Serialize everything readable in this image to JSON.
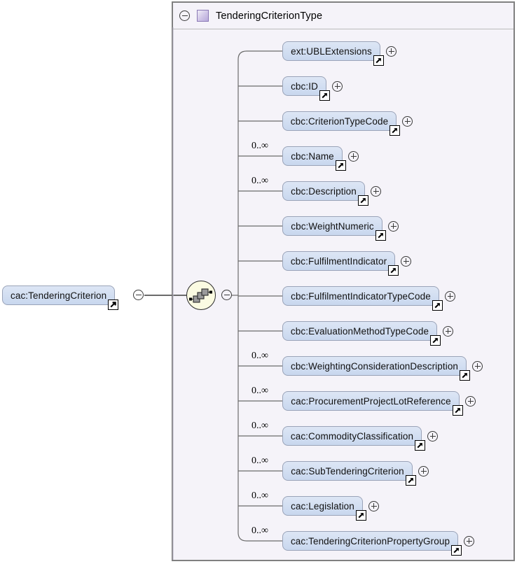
{
  "diagram": {
    "kind": "xsd-schema-diagram",
    "colors": {
      "panel_background": "#f5f3f9",
      "panel_border": "#808080",
      "node_fill_top": "#dde6f5",
      "node_fill_bottom": "#c8d7ee",
      "node_border": "#9aa3b8",
      "compositor_fill": "#fbfbe2",
      "type_swatch": "#b7a9dc",
      "line": "#6b6b6b"
    }
  },
  "root_element": {
    "label": "cac:TenderingCriterion",
    "toggle_icon": "minus-circle-icon",
    "reference_icon": "external-reference-arrow-icon",
    "expanded": true
  },
  "type_panel": {
    "toggle_icon": "minus-circle-icon",
    "swatch_icon": "complex-type-swatch-icon",
    "title": "TenderingCriterionType"
  },
  "compositor": {
    "kind": "sequence",
    "icon": "sequence-compositor-icon",
    "toggle_icon": "minus-circle-icon",
    "expanded": true
  },
  "children": [
    {
      "label": "ext:UBLExtensions",
      "cardinality": "",
      "expand_icon": "plus-circle-icon",
      "reference_icon": "external-reference-arrow-icon"
    },
    {
      "label": "cbc:ID",
      "cardinality": "",
      "expand_icon": "plus-circle-icon",
      "reference_icon": "external-reference-arrow-icon"
    },
    {
      "label": "cbc:CriterionTypeCode",
      "cardinality": "",
      "expand_icon": "plus-circle-icon",
      "reference_icon": "external-reference-arrow-icon"
    },
    {
      "label": "cbc:Name",
      "cardinality": "0..∞",
      "expand_icon": "plus-circle-icon",
      "reference_icon": "external-reference-arrow-icon"
    },
    {
      "label": "cbc:Description",
      "cardinality": "0..∞",
      "expand_icon": "plus-circle-icon",
      "reference_icon": "external-reference-arrow-icon"
    },
    {
      "label": "cbc:WeightNumeric",
      "cardinality": "",
      "expand_icon": "plus-circle-icon",
      "reference_icon": "external-reference-arrow-icon"
    },
    {
      "label": "cbc:FulfilmentIndicator",
      "cardinality": "",
      "expand_icon": "plus-circle-icon",
      "reference_icon": "external-reference-arrow-icon"
    },
    {
      "label": "cbc:FulfilmentIndicatorTypeCode",
      "cardinality": "",
      "expand_icon": "plus-circle-icon",
      "reference_icon": "external-reference-arrow-icon"
    },
    {
      "label": "cbc:EvaluationMethodTypeCode",
      "cardinality": "",
      "expand_icon": "plus-circle-icon",
      "reference_icon": "external-reference-arrow-icon"
    },
    {
      "label": "cbc:WeightingConsiderationDescription",
      "cardinality": "0..∞",
      "expand_icon": "plus-circle-icon",
      "reference_icon": "external-reference-arrow-icon"
    },
    {
      "label": "cac:ProcurementProjectLotReference",
      "cardinality": "0..∞",
      "expand_icon": "plus-circle-icon",
      "reference_icon": "external-reference-arrow-icon"
    },
    {
      "label": "cac:CommodityClassification",
      "cardinality": "0..∞",
      "expand_icon": "plus-circle-icon",
      "reference_icon": "external-reference-arrow-icon"
    },
    {
      "label": "cac:SubTenderingCriterion",
      "cardinality": "0..∞",
      "expand_icon": "plus-circle-icon",
      "reference_icon": "external-reference-arrow-icon"
    },
    {
      "label": "cac:Legislation",
      "cardinality": "0..∞",
      "expand_icon": "plus-circle-icon",
      "reference_icon": "external-reference-arrow-icon"
    },
    {
      "label": "cac:TenderingCriterionPropertyGroup",
      "cardinality": "0..∞",
      "expand_icon": "plus-circle-icon",
      "reference_icon": "external-reference-arrow-icon"
    }
  ]
}
